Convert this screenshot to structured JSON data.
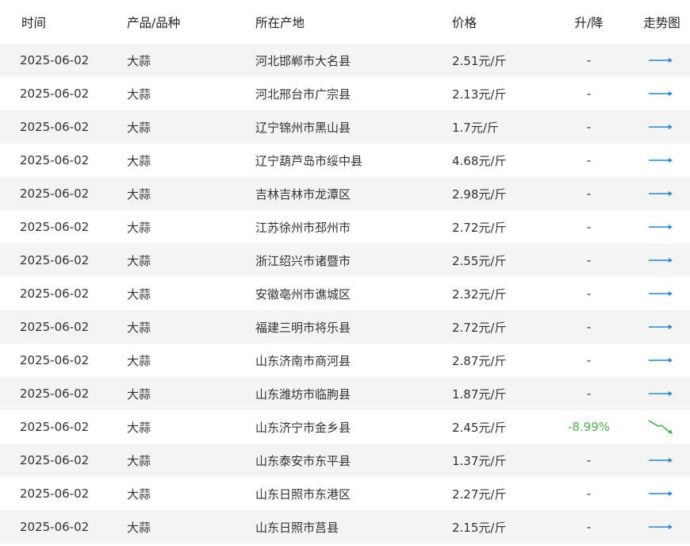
{
  "headers": {
    "time": "时间",
    "product": "产品/品种",
    "origin": "所在产地",
    "price": "价格",
    "change": "升/降",
    "trend": "走势图"
  },
  "colors": {
    "flat_arrow": "#1e88e5",
    "down_arrow": "#4caf50",
    "down_text": "#4caf50",
    "row_stripe": "#f4f4f4"
  },
  "rows": [
    {
      "time": "2025-06-02",
      "product": "大蒜",
      "origin": "河北邯郸市大名县",
      "price": "2.51元/斤",
      "change": "-",
      "trend": "flat"
    },
    {
      "time": "2025-06-02",
      "product": "大蒜",
      "origin": "河北邢台市广宗县",
      "price": "2.13元/斤",
      "change": "-",
      "trend": "flat"
    },
    {
      "time": "2025-06-02",
      "product": "大蒜",
      "origin": "辽宁锦州市黑山县",
      "price": "1.7元/斤",
      "change": "-",
      "trend": "flat"
    },
    {
      "time": "2025-06-02",
      "product": "大蒜",
      "origin": "辽宁葫芦岛市绥中县",
      "price": "4.68元/斤",
      "change": "-",
      "trend": "flat"
    },
    {
      "time": "2025-06-02",
      "product": "大蒜",
      "origin": "吉林吉林市龙潭区",
      "price": "2.98元/斤",
      "change": "-",
      "trend": "flat"
    },
    {
      "time": "2025-06-02",
      "product": "大蒜",
      "origin": "江苏徐州市邳州市",
      "price": "2.72元/斤",
      "change": "-",
      "trend": "flat"
    },
    {
      "time": "2025-06-02",
      "product": "大蒜",
      "origin": "浙江绍兴市诸暨市",
      "price": "2.55元/斤",
      "change": "-",
      "trend": "flat"
    },
    {
      "time": "2025-06-02",
      "product": "大蒜",
      "origin": "安徽亳州市谯城区",
      "price": "2.32元/斤",
      "change": "-",
      "trend": "flat"
    },
    {
      "time": "2025-06-02",
      "product": "大蒜",
      "origin": "福建三明市将乐县",
      "price": "2.72元/斤",
      "change": "-",
      "trend": "flat"
    },
    {
      "time": "2025-06-02",
      "product": "大蒜",
      "origin": "山东济南市商河县",
      "price": "2.87元/斤",
      "change": "-",
      "trend": "flat"
    },
    {
      "time": "2025-06-02",
      "product": "大蒜",
      "origin": "山东潍坊市临朐县",
      "price": "1.87元/斤",
      "change": "-",
      "trend": "flat"
    },
    {
      "time": "2025-06-02",
      "product": "大蒜",
      "origin": "山东济宁市金乡县",
      "price": "2.45元/斤",
      "change": "-8.99%",
      "trend": "down"
    },
    {
      "time": "2025-06-02",
      "product": "大蒜",
      "origin": "山东泰安市东平县",
      "price": "1.37元/斤",
      "change": "-",
      "trend": "flat"
    },
    {
      "time": "2025-06-02",
      "product": "大蒜",
      "origin": "山东日照市东港区",
      "price": "2.27元/斤",
      "change": "-",
      "trend": "flat"
    },
    {
      "time": "2025-06-02",
      "product": "大蒜",
      "origin": "山东日照市莒县",
      "price": "2.15元/斤",
      "change": "-",
      "trend": "flat"
    }
  ]
}
